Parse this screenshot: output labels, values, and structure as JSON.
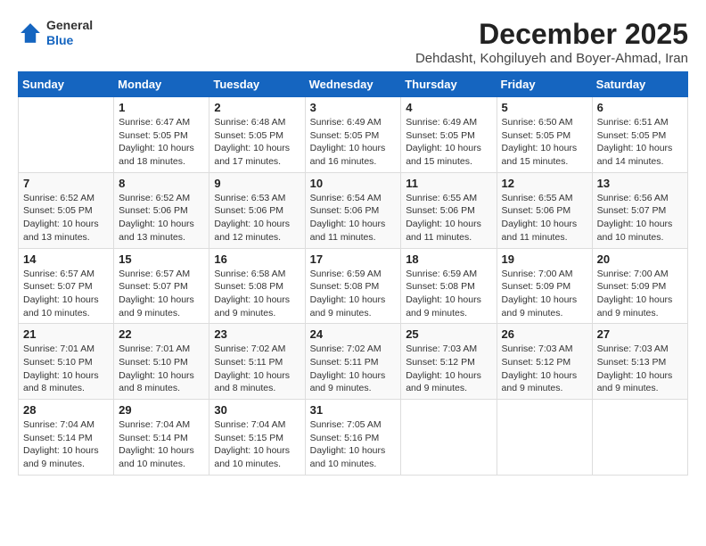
{
  "header": {
    "logo": {
      "general": "General",
      "blue": "Blue"
    },
    "month_year": "December 2025",
    "location": "Dehdasht, Kohgiluyeh and Boyer-Ahmad, Iran"
  },
  "weekdays": [
    "Sunday",
    "Monday",
    "Tuesday",
    "Wednesday",
    "Thursday",
    "Friday",
    "Saturday"
  ],
  "weeks": [
    [
      {
        "day": "",
        "detail": ""
      },
      {
        "day": "1",
        "detail": "Sunrise: 6:47 AM\nSunset: 5:05 PM\nDaylight: 10 hours\nand 18 minutes."
      },
      {
        "day": "2",
        "detail": "Sunrise: 6:48 AM\nSunset: 5:05 PM\nDaylight: 10 hours\nand 17 minutes."
      },
      {
        "day": "3",
        "detail": "Sunrise: 6:49 AM\nSunset: 5:05 PM\nDaylight: 10 hours\nand 16 minutes."
      },
      {
        "day": "4",
        "detail": "Sunrise: 6:49 AM\nSunset: 5:05 PM\nDaylight: 10 hours\nand 15 minutes."
      },
      {
        "day": "5",
        "detail": "Sunrise: 6:50 AM\nSunset: 5:05 PM\nDaylight: 10 hours\nand 15 minutes."
      },
      {
        "day": "6",
        "detail": "Sunrise: 6:51 AM\nSunset: 5:05 PM\nDaylight: 10 hours\nand 14 minutes."
      }
    ],
    [
      {
        "day": "7",
        "detail": "Sunrise: 6:52 AM\nSunset: 5:05 PM\nDaylight: 10 hours\nand 13 minutes."
      },
      {
        "day": "8",
        "detail": "Sunrise: 6:52 AM\nSunset: 5:06 PM\nDaylight: 10 hours\nand 13 minutes."
      },
      {
        "day": "9",
        "detail": "Sunrise: 6:53 AM\nSunset: 5:06 PM\nDaylight: 10 hours\nand 12 minutes."
      },
      {
        "day": "10",
        "detail": "Sunrise: 6:54 AM\nSunset: 5:06 PM\nDaylight: 10 hours\nand 11 minutes."
      },
      {
        "day": "11",
        "detail": "Sunrise: 6:55 AM\nSunset: 5:06 PM\nDaylight: 10 hours\nand 11 minutes."
      },
      {
        "day": "12",
        "detail": "Sunrise: 6:55 AM\nSunset: 5:06 PM\nDaylight: 10 hours\nand 11 minutes."
      },
      {
        "day": "13",
        "detail": "Sunrise: 6:56 AM\nSunset: 5:07 PM\nDaylight: 10 hours\nand 10 minutes."
      }
    ],
    [
      {
        "day": "14",
        "detail": "Sunrise: 6:57 AM\nSunset: 5:07 PM\nDaylight: 10 hours\nand 10 minutes."
      },
      {
        "day": "15",
        "detail": "Sunrise: 6:57 AM\nSunset: 5:07 PM\nDaylight: 10 hours\nand 9 minutes."
      },
      {
        "day": "16",
        "detail": "Sunrise: 6:58 AM\nSunset: 5:08 PM\nDaylight: 10 hours\nand 9 minutes."
      },
      {
        "day": "17",
        "detail": "Sunrise: 6:59 AM\nSunset: 5:08 PM\nDaylight: 10 hours\nand 9 minutes."
      },
      {
        "day": "18",
        "detail": "Sunrise: 6:59 AM\nSunset: 5:08 PM\nDaylight: 10 hours\nand 9 minutes."
      },
      {
        "day": "19",
        "detail": "Sunrise: 7:00 AM\nSunset: 5:09 PM\nDaylight: 10 hours\nand 9 minutes."
      },
      {
        "day": "20",
        "detail": "Sunrise: 7:00 AM\nSunset: 5:09 PM\nDaylight: 10 hours\nand 9 minutes."
      }
    ],
    [
      {
        "day": "21",
        "detail": "Sunrise: 7:01 AM\nSunset: 5:10 PM\nDaylight: 10 hours\nand 8 minutes."
      },
      {
        "day": "22",
        "detail": "Sunrise: 7:01 AM\nSunset: 5:10 PM\nDaylight: 10 hours\nand 8 minutes."
      },
      {
        "day": "23",
        "detail": "Sunrise: 7:02 AM\nSunset: 5:11 PM\nDaylight: 10 hours\nand 8 minutes."
      },
      {
        "day": "24",
        "detail": "Sunrise: 7:02 AM\nSunset: 5:11 PM\nDaylight: 10 hours\nand 9 minutes."
      },
      {
        "day": "25",
        "detail": "Sunrise: 7:03 AM\nSunset: 5:12 PM\nDaylight: 10 hours\nand 9 minutes."
      },
      {
        "day": "26",
        "detail": "Sunrise: 7:03 AM\nSunset: 5:12 PM\nDaylight: 10 hours\nand 9 minutes."
      },
      {
        "day": "27",
        "detail": "Sunrise: 7:03 AM\nSunset: 5:13 PM\nDaylight: 10 hours\nand 9 minutes."
      }
    ],
    [
      {
        "day": "28",
        "detail": "Sunrise: 7:04 AM\nSunset: 5:14 PM\nDaylight: 10 hours\nand 9 minutes."
      },
      {
        "day": "29",
        "detail": "Sunrise: 7:04 AM\nSunset: 5:14 PM\nDaylight: 10 hours\nand 10 minutes."
      },
      {
        "day": "30",
        "detail": "Sunrise: 7:04 AM\nSunset: 5:15 PM\nDaylight: 10 hours\nand 10 minutes."
      },
      {
        "day": "31",
        "detail": "Sunrise: 7:05 AM\nSunset: 5:16 PM\nDaylight: 10 hours\nand 10 minutes."
      },
      {
        "day": "",
        "detail": ""
      },
      {
        "day": "",
        "detail": ""
      },
      {
        "day": "",
        "detail": ""
      }
    ]
  ]
}
